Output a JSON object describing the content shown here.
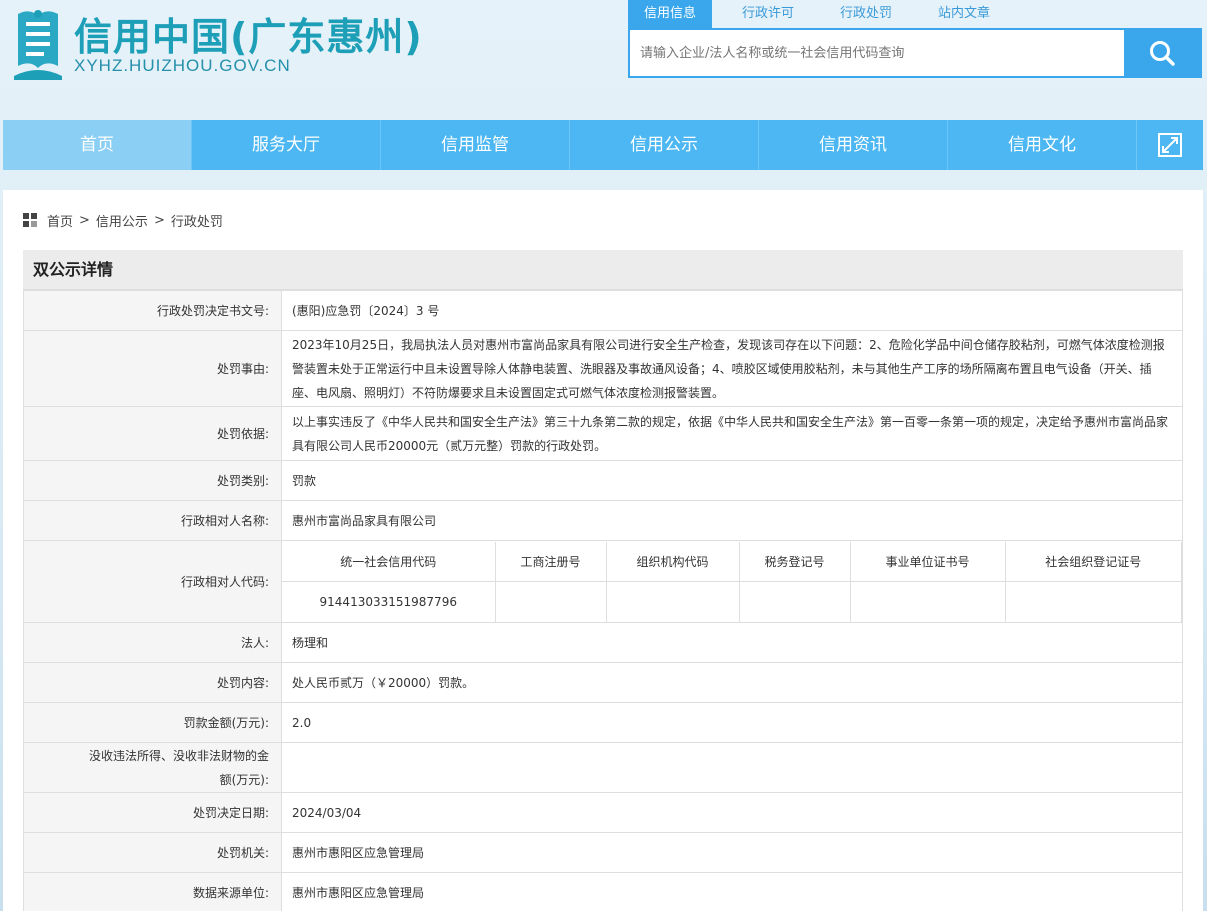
{
  "header": {
    "site_title": "信用中国(广东惠州)",
    "site_url": "XYHZ.HUIZHOU.GOV.CN",
    "logo_icon": "site-logo-icon"
  },
  "search": {
    "tabs": [
      "信用信息",
      "行政许可",
      "行政处罚",
      "站内文章"
    ],
    "placeholder": "请输入企业/法人名称或统一社会信用代码查询",
    "icon": "search-icon"
  },
  "nav": {
    "items": [
      "首页",
      "服务大厅",
      "信用监管",
      "信用公示",
      "信用资讯",
      "信用文化"
    ],
    "expand_icon": "expand-icon"
  },
  "breadcrumb": [
    "首页",
    "信用公示",
    "行政处罚"
  ],
  "detail": {
    "title": "双公示详情",
    "rows": {
      "decision_no": {
        "label": "行政处罚决定书文号:",
        "value": "(惠阳)应急罚〔2024〕3 号"
      },
      "reason": {
        "label": "处罚事由:",
        "value": "2023年10月25日，我局执法人员对惠州市富尚品家具有限公司进行安全生产检查，发现该司存在以下问题：2、危险化学品中间仓储存胶粘剂，可燃气体浓度检测报警装置未处于正常运行中且未设置导除人体静电装置、洗眼器及事故通风设备；4、喷胶区域使用胶粘剂，未与其他生产工序的场所隔离布置且电气设备（开关、插座、电风扇、照明灯）不符防爆要求且未设置固定式可燃气体浓度检测报警装置。"
      },
      "basis": {
        "label": "处罚依据:",
        "value": "以上事实违反了《中华人民共和国安全生产法》第三十九条第二款的规定，依据《中华人民共和国安全生产法》第一百零一条第一项的规定，决定给予惠州市富尚品家具有限公司人民币20000元（贰万元整）罚款的行政处罚。"
      },
      "category": {
        "label": "处罚类别:",
        "value": "罚款"
      },
      "party_name": {
        "label": "行政相对人名称:",
        "value": "惠州市富尚品家具有限公司"
      },
      "party_code": {
        "label": "行政相对人代码:",
        "headers": [
          "统一社会信用代码",
          "工商注册号",
          "组织机构代码",
          "税务登记号",
          "事业单位证书号",
          "社会组织登记证号"
        ],
        "values": [
          "914413033151987796",
          "",
          "",
          "",
          "",
          ""
        ]
      },
      "legal_person": {
        "label": "法人:",
        "value": "杨理和"
      },
      "content": {
        "label": "处罚内容:",
        "value": "处人民币贰万（￥20000）罚款。"
      },
      "fine_amount": {
        "label": "罚款金额(万元):",
        "value": "2.0"
      },
      "confiscation": {
        "label": "没收违法所得、没收非法财物的金额(万元):",
        "value": ""
      },
      "decision_date": {
        "label": "处罚决定日期:",
        "value": "2024/03/04"
      },
      "authority": {
        "label": "处罚机关:",
        "value": "惠州市惠阳区应急管理局"
      },
      "data_source": {
        "label": "数据来源单位:",
        "value": "惠州市惠阳区应急管理局"
      }
    }
  },
  "colors": {
    "accent": "#3aa7ec",
    "nav": "#4cb7f2",
    "nav_active": "#8ccff5",
    "brand": "#1e9fb8"
  }
}
